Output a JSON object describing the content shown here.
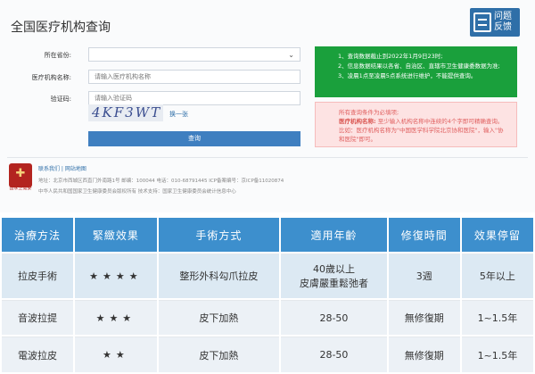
{
  "header": {
    "title": "全国医疗机构查询",
    "feedback_line1": "问题",
    "feedback_line2": "反馈"
  },
  "form": {
    "province_label": "所在省份:",
    "province_value": "",
    "name_label": "医疗机构名称:",
    "name_placeholder": "请输入医疗机构名称",
    "code_label": "验证码:",
    "code_placeholder": "请输入验证码",
    "captcha_text": "4KF3WT",
    "refresh_label": "换一张",
    "submit_label": "查询"
  },
  "notice_green": {
    "line1": "1、查询数据截止到2022年1月9日23时;",
    "line2": "2、信息数据结果以各省、自治区、直辖市卫生健康委数据为准;",
    "line3": "3、凌晨1点至凌晨5点系统进行维护，不能提供查询。"
  },
  "notice_pink": {
    "line1": "所有查询条件为必填项;",
    "line2_bold": "医疗机构名称:",
    "line2_rest": "至少输入机构名称中连续的4个字即可精确查询。比如：医疗机构名称为\"中国医学科学院北京协和医院\"，输入\"协和医院\"即可。"
  },
  "footer": {
    "emblem_caption": "国家卫健委",
    "links": "联系我们 | 网站地图",
    "line1": "地址：北京市西城区西直门外南路1号    邮编：100044    电话：010-68791445    ICP备案编号：京ICP备11020874",
    "line2": "中华人民共和国国家卫生健康委员会版权所有    技术支持：国家卫生健康委员会统计信息中心"
  },
  "comparison": {
    "headers": [
      "治療方法",
      "緊緻效果",
      "手術方式",
      "適用年齡",
      "修復時間",
      "效果停留"
    ],
    "rows": [
      {
        "method": "拉皮手術",
        "stars": "★★★★",
        "star_count": 4,
        "procedure": "整形外科勾爪拉皮",
        "age_line1": "40歲以上",
        "age_line2": "皮膚嚴重鬆弛者",
        "recovery": "3週",
        "duration": "5年以上"
      },
      {
        "method": "音波拉提",
        "stars": "★★★",
        "star_count": 3,
        "procedure": "皮下加熱",
        "age_line1": "28-50",
        "age_line2": "",
        "recovery": "無修復期",
        "duration": "1~1.5年"
      },
      {
        "method": "電波拉皮",
        "stars": "★★",
        "star_count": 2,
        "procedure": "皮下加熱",
        "age_line1": "28-50",
        "age_line2": "",
        "recovery": "無修復期",
        "duration": "1~1.5年"
      }
    ]
  },
  "colors": {
    "header_blue": "#3d8fcd",
    "notice_green": "#1aa03c",
    "notice_pink": "#fde3e3",
    "star": "#f2b50b"
  }
}
